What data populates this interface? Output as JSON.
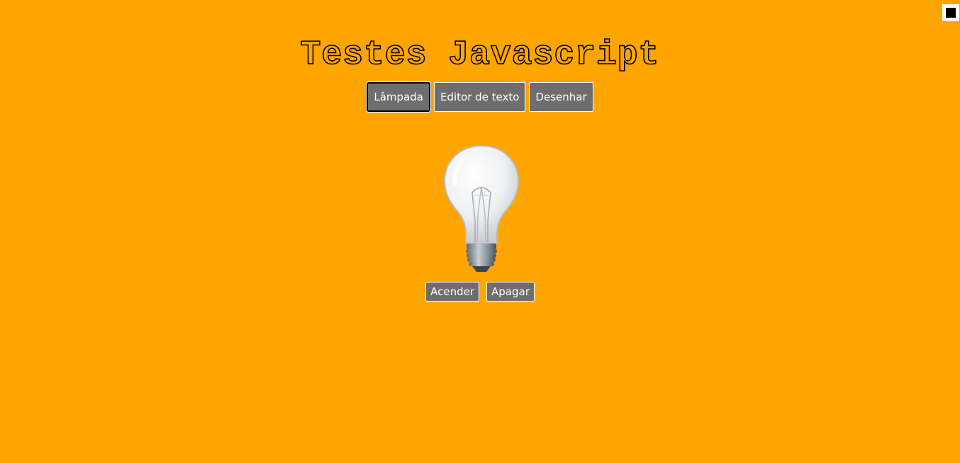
{
  "page": {
    "title": "Testes Javascript",
    "background_color": "#ffa500"
  },
  "nav": {
    "tabs": [
      {
        "label": "Lâmpada",
        "active": true
      },
      {
        "label": "Editor de texto",
        "active": false
      },
      {
        "label": "Desenhar",
        "active": false
      }
    ]
  },
  "lamp": {
    "state": "off",
    "icon": "lightbulb-icon",
    "buttons": {
      "on_label": "Acender",
      "off_label": "Apagar"
    }
  },
  "corner_toggle": {
    "icon": "square-icon",
    "color": "#000000"
  }
}
